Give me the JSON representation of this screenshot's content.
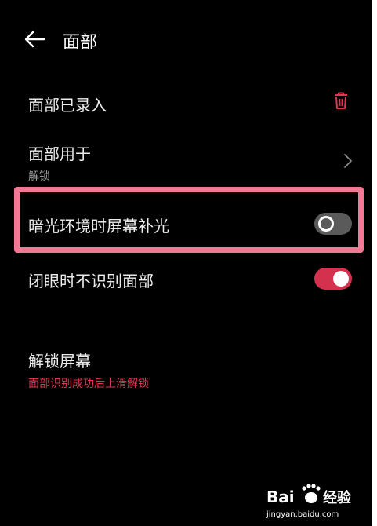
{
  "header": {
    "title": "面部"
  },
  "rows": {
    "enrolled": {
      "label": "面部已录入"
    },
    "use_for": {
      "label": "面部用于",
      "value": "解锁"
    },
    "low_light": {
      "label": "暗光环境时屏幕补光",
      "enabled": false
    },
    "eyes_closed": {
      "label": "闭眼时不识别面部",
      "enabled": true
    },
    "unlock_screen": {
      "label": "解锁屏幕",
      "description": "面部识别成功后上滑解锁"
    }
  },
  "watermark": {
    "brand": "Bai",
    "brand_suffix": "经验",
    "url": "jingyan.baidu.com"
  },
  "colors": {
    "accent": "#d4314f",
    "highlight": "#f07a95",
    "background": "#000000"
  },
  "icons": {
    "back": "arrow-left-icon",
    "delete": "trash-icon",
    "more": "chevron-right-icon"
  }
}
